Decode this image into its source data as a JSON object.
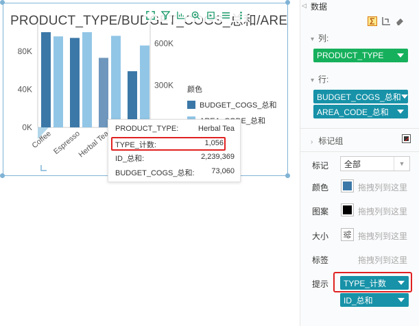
{
  "card": {
    "title": "PRODUCT_TYPE/BUDGET_COGS_总和/AREA_CODE_总和",
    "toolbar_icons": [
      "expand-icon",
      "filter-icon",
      "chart-type-icon",
      "zoom-icon",
      "export-icon",
      "list-icon",
      "more-icon"
    ]
  },
  "chart_data": {
    "type": "bar",
    "categories": [
      "Coffee",
      "Espresso",
      "Herbal Tea",
      "Tea"
    ],
    "series": [
      {
        "name": "BUDGET_COGS_总和",
        "axis": "left",
        "color": "#3b78a8",
        "values": [
          100000,
          94000,
          73060,
          59000
        ]
      },
      {
        "name": "AREA_CODE_总和",
        "axis": "right",
        "color": "#92c6e6",
        "values": [
          650000,
          680000,
          654000,
          585000
        ]
      }
    ],
    "y_left_ticks": [
      "0K",
      "40K",
      "80K"
    ],
    "y_right_ticks": [
      "300K",
      "600K"
    ],
    "ylim_left": [
      0,
      100000
    ],
    "ylim_right": [
      0,
      680000
    ],
    "highlight_category": "Herbal Tea"
  },
  "legend": {
    "title": "颜色",
    "items": [
      {
        "label": "BUDGET_COGS_总和",
        "color": "#3b78a8"
      },
      {
        "label": "AREA_CODE_总和",
        "color": "#92c6e6"
      }
    ]
  },
  "tooltip": {
    "rows": [
      {
        "key": "PRODUCT_TYPE:",
        "value": "Herbal Tea"
      },
      {
        "key": "TYPE_计数:",
        "value": "1,056"
      },
      {
        "key": "ID_总和:",
        "value": "2,239,369"
      },
      {
        "key": "BUDGET_COGS_总和:",
        "value": "73,060"
      }
    ]
  },
  "panel": {
    "collapse_glyph": "◁",
    "title": "数据",
    "icons": [
      "sum-icon",
      "axis-swap-icon",
      "eraser-icon"
    ],
    "columns_label": "列:",
    "columns_pill": "PRODUCT_TYPE",
    "rows_label": "行:",
    "rows_pills": [
      "BUDGET_COGS_总和",
      "AREA_CODE_总和"
    ],
    "mark_group_label": "标记组",
    "mark_label": "标记",
    "mark_select_value": "全部",
    "properties": [
      {
        "label": "颜色",
        "hint": "拖拽列到这里",
        "button_icon": "color-swatch-icon",
        "swatch": "#3b78a8"
      },
      {
        "label": "图案",
        "hint": "拖拽列到这里",
        "button_icon": "pattern-icon",
        "swatch": "#000000"
      },
      {
        "label": "大小",
        "hint": "拖拽列到这里",
        "button_icon": "size-icon",
        "swatch": ""
      },
      {
        "label": "标签",
        "hint": "拖拽列到这里",
        "button_icon": "",
        "swatch": ""
      }
    ],
    "tooltip_label": "提示",
    "tooltip_pills": [
      "TYPE_计数",
      "ID_总和"
    ]
  }
}
